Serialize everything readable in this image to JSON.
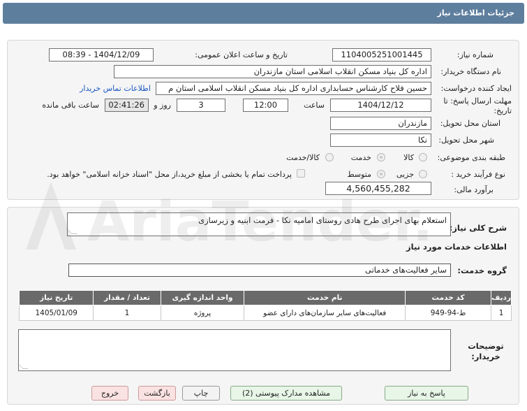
{
  "window": {
    "title": "جزئیات اطلاعات نیاز"
  },
  "form": {
    "need_number": {
      "label": "شماره نیاز:",
      "value": "1104005251001445"
    },
    "announce_datetime": {
      "label": "تاریخ و ساعت اعلان عمومی:",
      "value": "1404/12/09 - 08:39"
    },
    "buyer_org": {
      "label": "نام دستگاه خریدار:",
      "value": "اداره کل بنیاد مسکن انقلاب اسلامی استان مازندران"
    },
    "creator": {
      "label": "ایجاد کننده درخواست:",
      "value": "حسین فلاح کارشناس حسابداری اداره کل بنیاد مسکن انقلاب اسلامی استان م",
      "contact_link": "اطلاعات تماس خریدار"
    },
    "deadline": {
      "label": "مهلت ارسال پاسخ: تا تاریخ:",
      "date": "1404/12/12",
      "time_label": "ساعت",
      "time": "12:00",
      "days": "3",
      "days_label": "روز و",
      "remaining": "02:41:26",
      "remaining_label": "ساعت باقی مانده"
    },
    "province": {
      "label": "استان محل تحویل:",
      "value": "مازندران"
    },
    "city": {
      "label": "شهر محل تحویل:",
      "value": "نکا"
    },
    "category": {
      "label": "طبقه بندی موضوعی:",
      "options": [
        "کالا",
        "خدمت",
        "کالا/خدمت"
      ],
      "selected": "خدمت"
    },
    "process": {
      "label": "نوع فرآیند خرید :",
      "options": [
        "جزیی",
        "متوسط"
      ],
      "selected": "متوسط",
      "payment_note": "پرداخت تمام یا بخشی از مبلغ خرید،از محل \"اسناد خزانه اسلامی\" خواهد بود."
    },
    "estimate": {
      "label": "برآورد مالی:",
      "value": "4,560,455,282"
    }
  },
  "details": {
    "description_label": "شرح کلی نیاز:",
    "description": "استعلام بهای اجرای طرح هادی روستای امامیه نکا - فرمت ابنیه و زیرسازی",
    "services_heading": "اطلاعات خدمات مورد نیاز",
    "service_group_label": "گروه خدمت:",
    "service_group": "سایر فعالیت‌های خدماتی",
    "table": {
      "headers": [
        "ردیف",
        "کد خدمت",
        "نام خدمت",
        "واحد اندازه گیری",
        "تعداد / مقدار",
        "تاریخ نیاز"
      ],
      "rows": [
        [
          "1",
          "ط-94-949",
          "فعالیت‌های سایر سازمان‌های دارای عضو",
          "پروژه",
          "1",
          "1405/01/09"
        ]
      ]
    },
    "buyer_notes_label": "توضیحات خریدار:",
    "buyer_notes": ""
  },
  "buttons": {
    "reply": "پاسخ به نیاز",
    "attachments": "مشاهده مدارک پیوستی (2)",
    "print": "چاپ",
    "back": "بازگشت",
    "exit": "خروج"
  },
  "watermark": {
    "text": "AriaTender.neT"
  },
  "colors": {
    "titlebar": "#5e7e9e",
    "link": "#1a57c4",
    "table_header": "#6a6a6a"
  }
}
